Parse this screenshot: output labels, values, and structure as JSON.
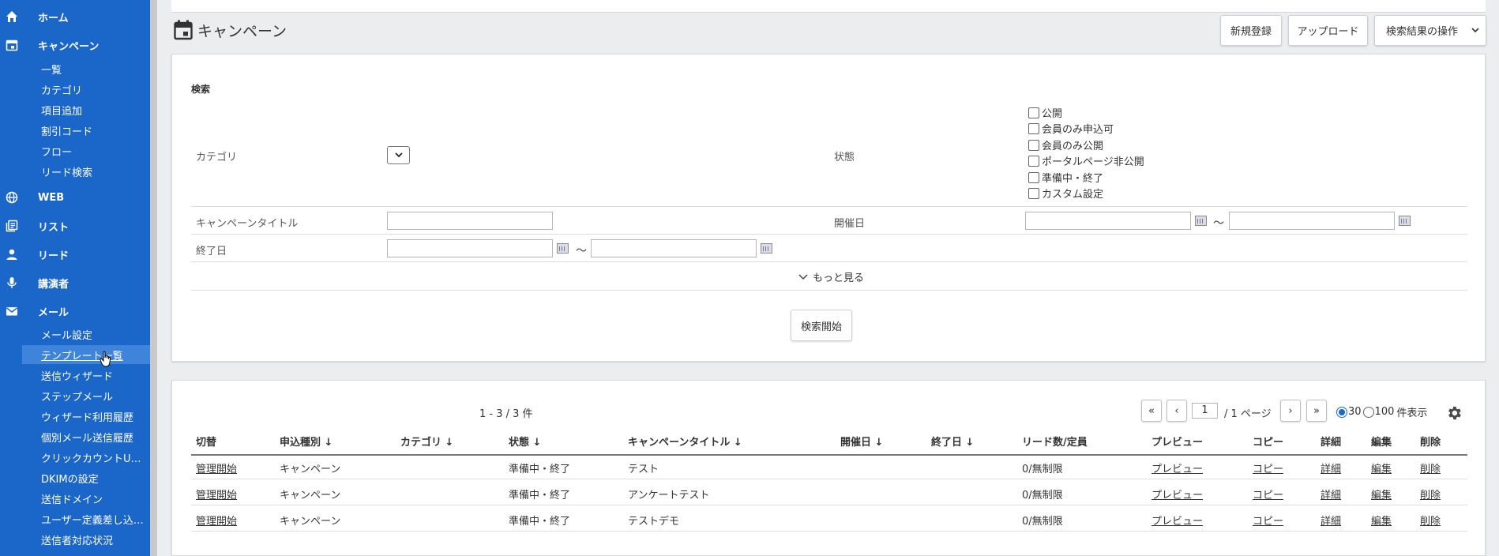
{
  "sidebar": {
    "sections": [
      {
        "label": "ホーム",
        "icon": "home-icon"
      },
      {
        "label": "キャンペーン",
        "icon": "calendar-icon"
      },
      {
        "label": "WEB",
        "icon": "globe-icon"
      },
      {
        "label": "リスト",
        "icon": "list-icon"
      },
      {
        "label": "リード",
        "icon": "person-icon"
      },
      {
        "label": "講演者",
        "icon": "microphone-icon"
      },
      {
        "label": "メール",
        "icon": "mail-icon"
      }
    ],
    "campaign_items": [
      "一覧",
      "カテゴリ",
      "項目追加",
      "割引コード",
      "フロー",
      "リード検索"
    ],
    "mail_items": [
      "メール設定",
      "テンプレート一覧",
      "送信ウィザード",
      "ステップメール",
      "ウィザード利用履歴",
      "個別メール送信履歴",
      "クリックカウントU…",
      "DKIMの設定",
      "送信ドメイン",
      "ユーザー定義差し込…",
      "送信者対応状況"
    ]
  },
  "header": {
    "title": "キャンペーン",
    "new_button": "新規登録",
    "upload_button": "アップロード",
    "results_action": "検索結果の操作"
  },
  "search": {
    "heading": "検索",
    "category_label": "カテゴリ",
    "status_label": "状態",
    "status_options": [
      "公開",
      "会員のみ申込可",
      "会員のみ公開",
      "ポータルページ非公開",
      "準備中・終了",
      "カスタム設定"
    ],
    "campaign_title_label": "キャンペーンタイトル",
    "start_date_label": "開催日",
    "end_date_label": "終了日",
    "tilde": "～",
    "more_label": "もっと見る",
    "search_button": "検索開始"
  },
  "results": {
    "count_text": "1 - 3 / 3 件",
    "pagination": {
      "first": "«",
      "prev": "‹",
      "page": "1",
      "total": "/ 1 ページ",
      "next": "›",
      "last": "»",
      "per_page_options": [
        "30",
        "100"
      ],
      "per_page_selected": "30",
      "per_page_suffix": "件表示"
    },
    "columns": [
      "切替",
      "申込種別 ↓",
      "カテゴリ ↓",
      "状態 ↓",
      "キャンペーンタイトル ↓",
      "開催日 ↓",
      "終了日 ↓",
      "リード数/定員",
      "プレビュー",
      "コピー",
      "詳細",
      "編集",
      "削除"
    ],
    "rows": [
      {
        "toggle": "管理開始",
        "type": "キャンペーン",
        "category": "",
        "status": "準備中・終了",
        "title": "テスト",
        "start": "",
        "end": "",
        "leads": "0/無制限",
        "preview": "プレビュー",
        "copy": "コピー",
        "detail": "詳細",
        "edit": "編集",
        "delete": "削除"
      },
      {
        "toggle": "管理開始",
        "type": "キャンペーン",
        "category": "",
        "status": "準備中・終了",
        "title": "アンケートテスト",
        "start": "",
        "end": "",
        "leads": "0/無制限",
        "preview": "プレビュー",
        "copy": "コピー",
        "detail": "詳細",
        "edit": "編集",
        "delete": "削除"
      },
      {
        "toggle": "管理開始",
        "type": "キャンペーン",
        "category": "",
        "status": "準備中・終了",
        "title": "テストデモ",
        "start": "",
        "end": "",
        "leads": "0/無制限",
        "preview": "プレビュー",
        "copy": "コピー",
        "detail": "詳細",
        "edit": "編集",
        "delete": "削除"
      }
    ]
  },
  "colors": {
    "sidebar": "#1a66c9",
    "sidebar_active": "#3f84db"
  }
}
